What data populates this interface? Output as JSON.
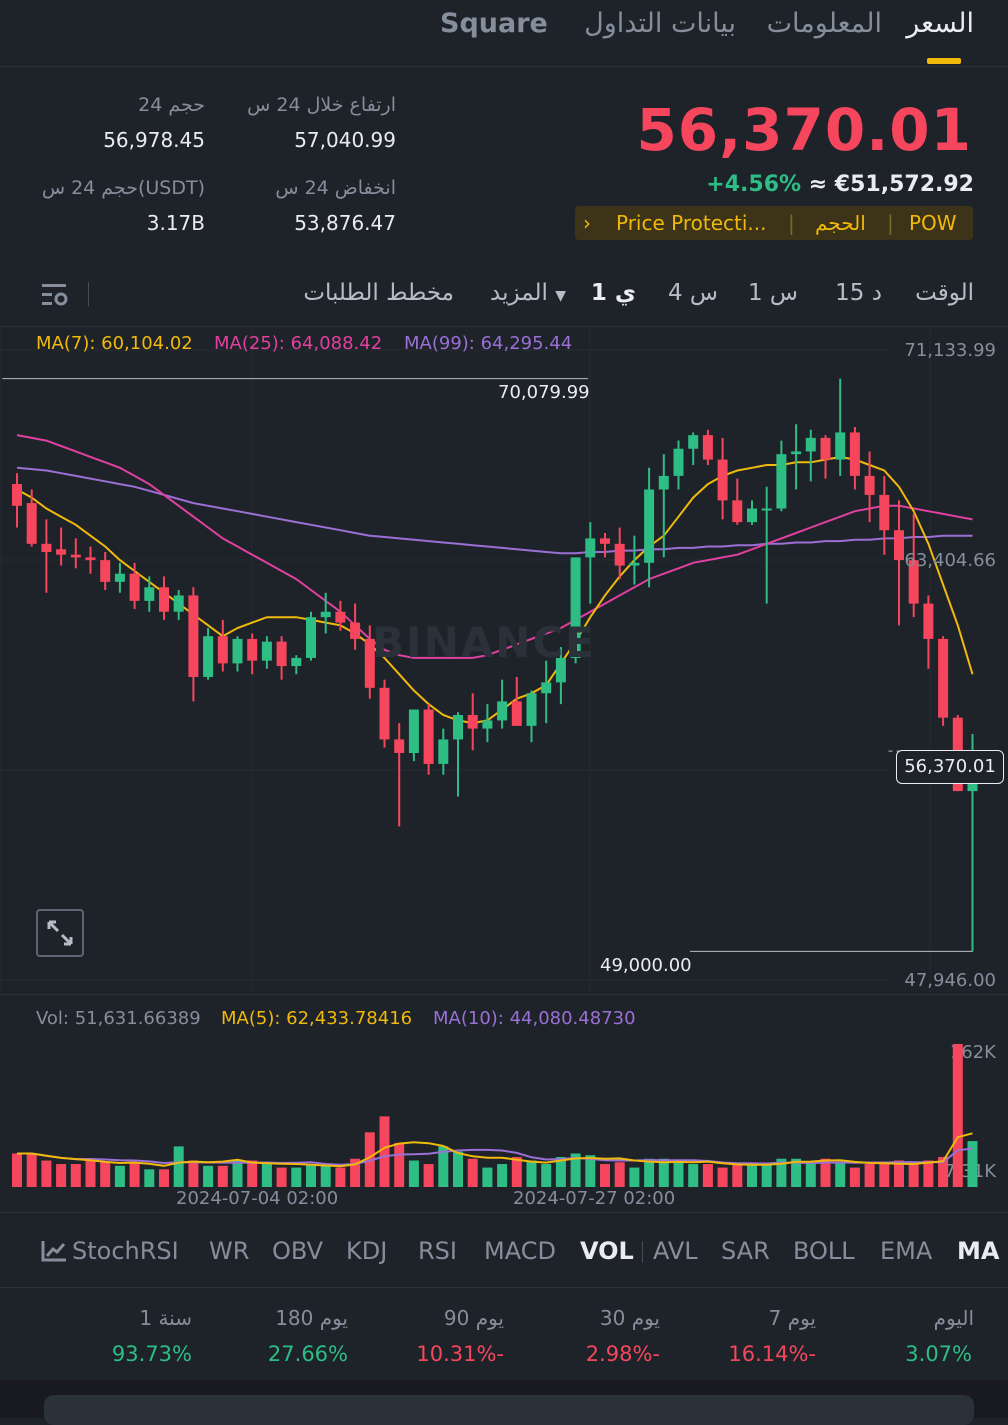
{
  "tabs": [
    {
      "label": "السعر",
      "active": true
    },
    {
      "label": "المعلومات",
      "active": false
    },
    {
      "label": "بيانات التداول",
      "active": false
    },
    {
      "label": "Square",
      "active": false
    }
  ],
  "header": {
    "last_price": "56,370.01",
    "fiat_equiv": "≈ €51,572.92",
    "change_pct": "+4.56%",
    "high_label": "ارتفاع خلال 24 س",
    "high_value": "57,040.99",
    "low_label": "انخفاض 24 س",
    "low_value": "53,876.47",
    "vol_label": "حجم 24",
    "vol_value": "56,978.45",
    "vol_usdt_label": "حجم 24 س(USDT)",
    "vol_usdt_value": "3.17B",
    "tags": {
      "arrow": "›",
      "price_protection": "Price Protecti...",
      "volume": "الحجم",
      "pow": "POW"
    }
  },
  "intervals": {
    "time_label": "الوقت",
    "options": [
      "15 د",
      "1 س",
      "4 س",
      "1 ي"
    ],
    "active": "1 ي",
    "more": "المزيد",
    "order_book": "مخطط الطلبات"
  },
  "chart": {
    "ma7": "MA(7): 60,104.02",
    "ma25": "MA(25): 64,088.42",
    "ma99": "MA(99): 64,295.44",
    "axis": [
      "71,133.99",
      "63,404.66",
      "47,946.00"
    ],
    "current_price_tag": "56,370.01",
    "high_marker": "70,079.99",
    "low_marker": "49,000.00",
    "watermark": "BINANCE",
    "colors": {
      "up": "#2ebd85",
      "down": "#f6465d",
      "ma7": "#f0b90b",
      "ma25": "#e040a0",
      "ma99": "#9b6fd6"
    }
  },
  "chart_data": {
    "type": "candlestick",
    "y_axis": {
      "top": 71133.99,
      "bottom": 47946.0
    },
    "high_marker": 70079.99,
    "low_marker": 49000.0,
    "last": 56370.01,
    "candles": [
      {
        "o": 66200,
        "h": 66600,
        "l": 64600,
        "c": 65400
      },
      {
        "o": 65500,
        "h": 66000,
        "l": 63900,
        "c": 64000
      },
      {
        "o": 64000,
        "h": 64900,
        "l": 62200,
        "c": 63700
      },
      {
        "o": 63800,
        "h": 64600,
        "l": 63200,
        "c": 63600
      },
      {
        "o": 63600,
        "h": 64200,
        "l": 63100,
        "c": 63500
      },
      {
        "o": 63500,
        "h": 63900,
        "l": 62900,
        "c": 63400
      },
      {
        "o": 63400,
        "h": 63700,
        "l": 62300,
        "c": 62600
      },
      {
        "o": 62600,
        "h": 63300,
        "l": 62200,
        "c": 62900
      },
      {
        "o": 62900,
        "h": 63300,
        "l": 61600,
        "c": 61900
      },
      {
        "o": 61900,
        "h": 62800,
        "l": 61500,
        "c": 62400
      },
      {
        "o": 62400,
        "h": 62800,
        "l": 61200,
        "c": 61500
      },
      {
        "o": 61500,
        "h": 62300,
        "l": 61200,
        "c": 62100
      },
      {
        "o": 62100,
        "h": 62400,
        "l": 58200,
        "c": 59100
      },
      {
        "o": 59100,
        "h": 60900,
        "l": 59000,
        "c": 60600
      },
      {
        "o": 60600,
        "h": 61200,
        "l": 59300,
        "c": 59600
      },
      {
        "o": 59600,
        "h": 60600,
        "l": 59300,
        "c": 60500
      },
      {
        "o": 60500,
        "h": 60700,
        "l": 59200,
        "c": 59700
      },
      {
        "o": 59700,
        "h": 60600,
        "l": 59400,
        "c": 60400
      },
      {
        "o": 60400,
        "h": 60600,
        "l": 59000,
        "c": 59500
      },
      {
        "o": 59500,
        "h": 59900,
        "l": 59200,
        "c": 59800
      },
      {
        "o": 59800,
        "h": 61500,
        "l": 59700,
        "c": 61300
      },
      {
        "o": 61300,
        "h": 62200,
        "l": 60700,
        "c": 61500
      },
      {
        "o": 61500,
        "h": 61900,
        "l": 60800,
        "c": 61100
      },
      {
        "o": 61100,
        "h": 61800,
        "l": 60100,
        "c": 60500
      },
      {
        "o": 60500,
        "h": 61000,
        "l": 58300,
        "c": 58700
      },
      {
        "o": 58700,
        "h": 59000,
        "l": 56500,
        "c": 56800
      },
      {
        "o": 56800,
        "h": 57400,
        "l": 53600,
        "c": 56300
      },
      {
        "o": 56300,
        "h": 57900,
        "l": 56000,
        "c": 57900
      },
      {
        "o": 57900,
        "h": 58100,
        "l": 55500,
        "c": 55900
      },
      {
        "o": 55900,
        "h": 57200,
        "l": 55500,
        "c": 56800
      },
      {
        "o": 56800,
        "h": 57800,
        "l": 54700,
        "c": 57700
      },
      {
        "o": 57700,
        "h": 58500,
        "l": 56400,
        "c": 57200
      },
      {
        "o": 57200,
        "h": 58100,
        "l": 56700,
        "c": 57500
      },
      {
        "o": 57500,
        "h": 59000,
        "l": 57200,
        "c": 58200
      },
      {
        "o": 58200,
        "h": 59100,
        "l": 57300,
        "c": 57300
      },
      {
        "o": 57300,
        "h": 58600,
        "l": 56700,
        "c": 58500
      },
      {
        "o": 58500,
        "h": 59700,
        "l": 57400,
        "c": 58900
      },
      {
        "o": 58900,
        "h": 60200,
        "l": 58100,
        "c": 59800
      },
      {
        "o": 59800,
        "h": 63500,
        "l": 59600,
        "c": 63500
      },
      {
        "o": 63500,
        "h": 64800,
        "l": 61800,
        "c": 64200
      },
      {
        "o": 64200,
        "h": 64400,
        "l": 63500,
        "c": 64000
      },
      {
        "o": 64000,
        "h": 64600,
        "l": 62700,
        "c": 63200
      },
      {
        "o": 63200,
        "h": 64300,
        "l": 62500,
        "c": 63300
      },
      {
        "o": 63300,
        "h": 66800,
        "l": 62400,
        "c": 66000
      },
      {
        "o": 66000,
        "h": 67300,
        "l": 63500,
        "c": 66500
      },
      {
        "o": 66500,
        "h": 67800,
        "l": 66000,
        "c": 67500
      },
      {
        "o": 67500,
        "h": 68100,
        "l": 66900,
        "c": 68000
      },
      {
        "o": 68000,
        "h": 68200,
        "l": 66900,
        "c": 67100
      },
      {
        "o": 67100,
        "h": 67900,
        "l": 64900,
        "c": 65600
      },
      {
        "o": 65600,
        "h": 66400,
        "l": 64700,
        "c": 64800
      },
      {
        "o": 64800,
        "h": 65600,
        "l": 64700,
        "c": 65300
      },
      {
        "o": 65300,
        "h": 66100,
        "l": 61800,
        "c": 65300
      },
      {
        "o": 65300,
        "h": 67800,
        "l": 65200,
        "c": 67300
      },
      {
        "o": 67300,
        "h": 68400,
        "l": 66000,
        "c": 67400
      },
      {
        "o": 67400,
        "h": 68200,
        "l": 66300,
        "c": 67900
      },
      {
        "o": 67900,
        "h": 68000,
        "l": 66400,
        "c": 67100
      },
      {
        "o": 67100,
        "h": 70080,
        "l": 66500,
        "c": 68100
      },
      {
        "o": 68100,
        "h": 68300,
        "l": 66000,
        "c": 66500
      },
      {
        "o": 66500,
        "h": 67400,
        "l": 64800,
        "c": 65800
      },
      {
        "o": 65800,
        "h": 66500,
        "l": 63600,
        "c": 64500
      },
      {
        "o": 64500,
        "h": 65600,
        "l": 61000,
        "c": 63400
      },
      {
        "o": 63400,
        "h": 65100,
        "l": 61300,
        "c": 61800
      },
      {
        "o": 61800,
        "h": 62100,
        "l": 59400,
        "c": 60500
      },
      {
        "o": 60500,
        "h": 60600,
        "l": 57300,
        "c": 57600
      },
      {
        "o": 57600,
        "h": 57700,
        "l": 54900,
        "c": 54900
      },
      {
        "o": 54900,
        "h": 57000,
        "l": 49000,
        "c": 56370
      }
    ],
    "ma7": [
      66000,
      65700,
      65300,
      65000,
      64700,
      64300,
      63900,
      63400,
      63000,
      62600,
      62200,
      61800,
      61400,
      61000,
      60600,
      60900,
      61100,
      61300,
      61300,
      61300,
      61200,
      61100,
      61000,
      60700,
      60300,
      59800,
      59200,
      58600,
      58100,
      57700,
      57500,
      57400,
      57500,
      57900,
      58300,
      58500,
      58800,
      59600,
      60400,
      61300,
      62100,
      62800,
      63400,
      63900,
      64300,
      65000,
      65700,
      66200,
      66500,
      66700,
      66800,
      66900,
      66900,
      67000,
      67000,
      67100,
      67200,
      67100,
      66900,
      66700,
      66100,
      65200,
      64000,
      62500,
      61000,
      59200
    ],
    "ma25": [
      68000,
      67900,
      67800,
      67600,
      67400,
      67200,
      67000,
      66800,
      66500,
      66200,
      65800,
      65400,
      65000,
      64600,
      64200,
      63900,
      63600,
      63300,
      63000,
      62700,
      62300,
      61900,
      61500,
      61000,
      60500,
      60100,
      59900,
      59800,
      59800,
      59800,
      59800,
      59800,
      59900,
      60100,
      60300,
      60500,
      60700,
      60900,
      61200,
      61500,
      61800,
      62100,
      62400,
      62700,
      62900,
      63100,
      63300,
      63400,
      63500,
      63600,
      63800,
      64000,
      64200,
      64400,
      64600,
      64800,
      65000,
      65200,
      65300,
      65400,
      65400,
      65300,
      65200,
      65100,
      65000,
      64900
    ],
    "ma99": [
      66800,
      66750,
      66700,
      66600,
      66500,
      66400,
      66300,
      66200,
      66100,
      65950,
      65800,
      65650,
      65500,
      65400,
      65300,
      65200,
      65100,
      65000,
      64900,
      64800,
      64700,
      64600,
      64500,
      64400,
      64300,
      64250,
      64200,
      64150,
      64100,
      64050,
      64000,
      63950,
      63900,
      63850,
      63800,
      63750,
      63700,
      63650,
      63650,
      63700,
      63700,
      63750,
      63750,
      63800,
      63800,
      63850,
      63850,
      63900,
      63900,
      63950,
      63950,
      64000,
      64000,
      64050,
      64050,
      64100,
      64100,
      64150,
      64150,
      64200,
      64200,
      64250,
      64250,
      64300,
      64300,
      64295
    ],
    "volume": {
      "label": "Vol: 51,631.66389",
      "ma5": "MA(5): 62,433.78416",
      "ma10": "MA(10): 44,080.48730",
      "axis": [
        "162K",
        "7.31K"
      ],
      "values": [
        38,
        38,
        30,
        26,
        26,
        32,
        28,
        24,
        28,
        20,
        20,
        46,
        30,
        24,
        24,
        30,
        30,
        26,
        22,
        22,
        26,
        26,
        22,
        32,
        62,
        80,
        50,
        30,
        26,
        46,
        40,
        32,
        22,
        26,
        34,
        30,
        26,
        34,
        38,
        36,
        26,
        28,
        22,
        32,
        32,
        28,
        26,
        26,
        22,
        26,
        26,
        26,
        32,
        32,
        28,
        32,
        28,
        22,
        26,
        26,
        30,
        26,
        30,
        34,
        162,
        52
      ],
      "dates": [
        "2024-07-04 02:00",
        "2024-07-27 02:00"
      ]
    }
  },
  "indicators": {
    "icon_label": "StochRSI",
    "items": [
      "WR",
      "OBV",
      "KDJ",
      "RSI",
      "MACD",
      "VOL",
      "AVL",
      "SAR",
      "BOLL",
      "EMA",
      "MA"
    ],
    "active": [
      "VOL",
      "MA"
    ]
  },
  "performance": [
    {
      "label": "اليوم",
      "value": "3.07%",
      "positive": true
    },
    {
      "label": "7 يوم",
      "value": "16.14%-",
      "positive": false
    },
    {
      "label": "30 يوم",
      "value": "2.98%-",
      "positive": false
    },
    {
      "label": "90 يوم",
      "value": "10.31%-",
      "positive": false
    },
    {
      "label": "180 يوم",
      "value": "27.66%",
      "positive": true
    },
    {
      "label": "1 سنة",
      "value": "93.73%",
      "positive": true
    }
  ]
}
